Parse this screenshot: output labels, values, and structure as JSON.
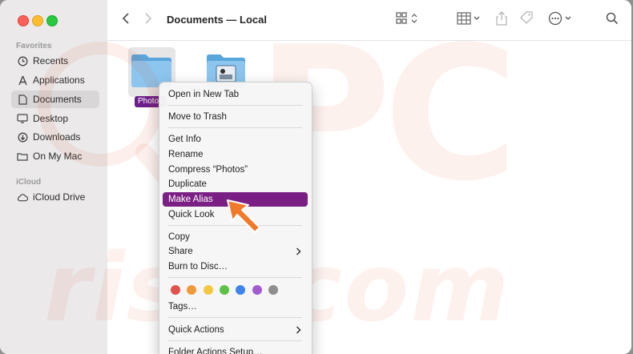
{
  "window": {
    "title": "Documents — Local"
  },
  "sidebar": {
    "sections": [
      {
        "label": "Favorites"
      },
      {
        "label": "iCloud"
      }
    ],
    "favorites": [
      {
        "label": "Recents",
        "icon": "clock-icon"
      },
      {
        "label": "Applications",
        "icon": "applications-icon"
      },
      {
        "label": "Documents",
        "icon": "document-icon",
        "selected": true
      },
      {
        "label": "Desktop",
        "icon": "desktop-icon"
      },
      {
        "label": "Downloads",
        "icon": "download-icon"
      },
      {
        "label": "On My Mac",
        "icon": "folder-icon"
      }
    ],
    "icloud": [
      {
        "label": "iCloud Drive",
        "icon": "cloud-icon"
      }
    ]
  },
  "files": [
    {
      "label": "Photos",
      "icon": "folder-icon",
      "selected": true
    },
    {
      "label": "",
      "icon": "image-folder-icon"
    }
  ],
  "context_menu": {
    "items": [
      {
        "label": "Open in New Tab"
      },
      {
        "label": "Move to Trash"
      },
      {
        "label": "Get Info"
      },
      {
        "label": "Rename"
      },
      {
        "label": "Compress “Photos”"
      },
      {
        "label": "Duplicate"
      },
      {
        "label": "Make Alias",
        "highlighted": true
      },
      {
        "label": "Quick Look"
      },
      {
        "label": "Copy"
      },
      {
        "label": "Share",
        "submenu": true
      },
      {
        "label": "Burn to Disc…"
      },
      {
        "label": "Tags…"
      },
      {
        "label": "Quick Actions",
        "submenu": true
      },
      {
        "label": "Folder Actions Setup…"
      }
    ],
    "tag_colors": [
      "#e0534b",
      "#f09b3a",
      "#f5c640",
      "#5cc245",
      "#3e86ec",
      "#a35bd0",
      "#8e8e8e"
    ]
  },
  "colors": {
    "highlight": "#7a1f84",
    "arrow": "#f07a2a"
  },
  "watermark": {
    "text": "risk.com"
  }
}
